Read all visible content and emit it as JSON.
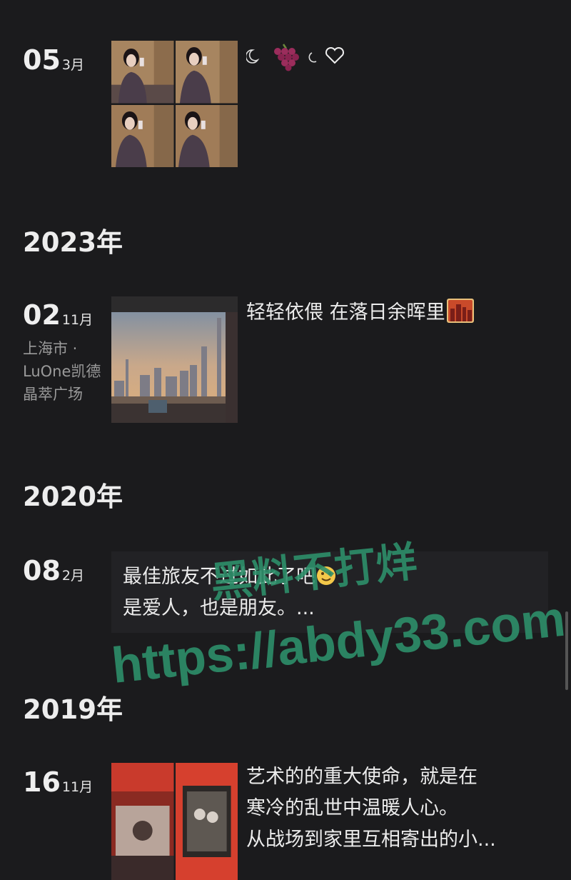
{
  "entries": [
    {
      "day": "05",
      "month": "3月",
      "caption": ""
    },
    {
      "day": "02",
      "month": "11月",
      "location": "上海市 · LuOne凯德晶萃广场",
      "caption": "轻轻依偎 在落日余晖里"
    },
    {
      "day": "08",
      "month": "2月",
      "caption_lines": [
        "最佳旅友不过如此了吧",
        "是爱人，也是朋友。..."
      ]
    },
    {
      "day": "16",
      "month": "11月",
      "caption_lines": [
        "艺术的的重大使命，就是在",
        "寒冷的乱世中温暖人心。",
        "从战场到家里互相寄出的小..."
      ]
    }
  ],
  "years": [
    "2023年",
    "2020年",
    "2019年"
  ],
  "watermark": {
    "line1": "黑料不打烊",
    "line2": "https://abdy33.com",
    "color": "#2e8f6a"
  },
  "icons": [
    "moon-icon",
    "grapes-icon",
    "heart-icon",
    "city-sunset-emoji",
    "smile-emoji"
  ]
}
